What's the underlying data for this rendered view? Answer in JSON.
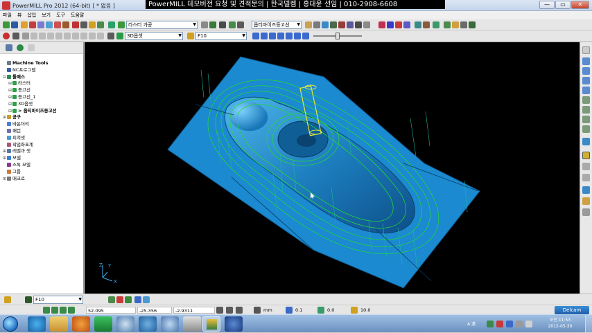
{
  "window": {
    "title": "PowerMILL Pro 2012 (64-bit)    [ * 없음 ]",
    "banner": "PowerMILL 데모버전 요청 및 견적문의  | 한국델켐 | 홍대윤 선임 | 010-2908-6608",
    "min_glyph": "—",
    "max_glyph": "▭",
    "close_glyph": "✕"
  },
  "menu": [
    "파일",
    "뷰",
    "삽입",
    "보기",
    "도구",
    "도움말"
  ],
  "toolbar1": {
    "strategy_combo": "라스터 가공",
    "toolpath_combo": "옵티마이즈등고선"
  },
  "toolbar2": {
    "tool_combo": "3D옵셋",
    "feature_combo": "F10"
  },
  "tree": {
    "items": [
      {
        "toggle": "",
        "label": "Machine Tools",
        "bold": true,
        "indent": 0,
        "color": "#6b7a8a"
      },
      {
        "toggle": "",
        "label": "NC프로그램",
        "bold": false,
        "indent": 0,
        "color": "#3a5fa8"
      },
      {
        "toggle": "⊟",
        "label": "툴패스",
        "bold": true,
        "indent": 0,
        "color": "#2e8b57"
      },
      {
        "toggle": "⊞",
        "label": "라스터",
        "bold": false,
        "indent": 2,
        "color": "#2ea04a"
      },
      {
        "toggle": "⊞",
        "label": "등고선",
        "bold": false,
        "indent": 2,
        "color": "#2ea04a"
      },
      {
        "toggle": "⊞",
        "label": "등고선_1",
        "bold": false,
        "indent": 2,
        "color": "#2ea04a"
      },
      {
        "toggle": "⊞",
        "label": "3D옵셋",
        "bold": false,
        "indent": 2,
        "color": "#2ea04a"
      },
      {
        "toggle": "⊞",
        "label": "> 옵티마이즈등고선",
        "bold": true,
        "indent": 2,
        "color": "#2ea04a"
      },
      {
        "toggle": "⊞",
        "label": "공구",
        "bold": true,
        "indent": 0,
        "color": "#c89a2a"
      },
      {
        "toggle": "",
        "label": "바운더리",
        "bold": false,
        "indent": 0,
        "color": "#4a7fd0"
      },
      {
        "toggle": "",
        "label": "패턴",
        "bold": false,
        "indent": 0,
        "color": "#6f6fb0"
      },
      {
        "toggle": "",
        "label": "피쳐셋",
        "bold": false,
        "indent": 0,
        "color": "#4a9ad0"
      },
      {
        "toggle": "",
        "label": "작업좌표계",
        "bold": false,
        "indent": 0,
        "color": "#aa5577"
      },
      {
        "toggle": "⊞",
        "label": "레벨과 셋",
        "bold": false,
        "indent": 0,
        "color": "#5577aa"
      },
      {
        "toggle": "⊞",
        "label": "모델",
        "bold": false,
        "indent": 0,
        "color": "#3a7fd0"
      },
      {
        "toggle": "",
        "label": "스톡 모델",
        "bold": false,
        "indent": 0,
        "color": "#8a3a8a"
      },
      {
        "toggle": "",
        "label": "그룹",
        "bold": false,
        "indent": 0,
        "color": "#c87a3a"
      },
      {
        "toggle": "⊞",
        "label": "매크로",
        "bold": false,
        "indent": 0,
        "color": "#777777"
      }
    ]
  },
  "axis": {
    "x": "X",
    "y": "Y",
    "z": "Z"
  },
  "status": {
    "feature": "F10",
    "coord_x": "52.095",
    "coord_y": "-25.356",
    "coord_z": "-2.9311",
    "units": "mm",
    "tolerance": "0.1",
    "stock": "0.0",
    "tool_dia": "10.0",
    "brand": "Delcam"
  },
  "clock": {
    "time": "오전 11:53",
    "date": "2012-05-30"
  },
  "tray": {
    "lang": "A 漢"
  },
  "colors": {
    "part": "#1e88c8",
    "toolpath": "#22d63a",
    "viewport_bg": "#000000",
    "tool": "#e6e63a"
  }
}
